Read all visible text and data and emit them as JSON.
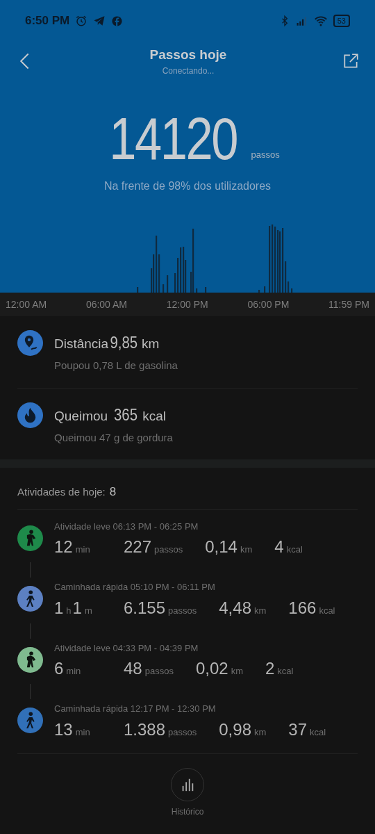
{
  "status_bar": {
    "time": "6:50 PM",
    "battery": "53"
  },
  "header": {
    "title": "Passos hoje",
    "subtitle": "Conectando..."
  },
  "summary": {
    "steps": "14120",
    "unit": "passos",
    "ranking": "Na frente de 98% dos utilizadores"
  },
  "chart_axis": [
    "12:00 AM",
    "06:00 AM",
    "12:00 PM",
    "06:00 PM",
    "11:59 PM"
  ],
  "stats": [
    {
      "kind": "distance",
      "label": "Distância",
      "value": "9,85",
      "unit": "km",
      "note": "Poupou 0,78 L de gasolina"
    },
    {
      "kind": "calories",
      "label": "Queimou",
      "value": "365",
      "unit": "kcal",
      "note": "Queimou 47 g de gordura"
    }
  ],
  "activities_header": {
    "label": "Atividades de hoje:",
    "count": "8"
  },
  "activities": [
    {
      "kind": "light",
      "color": "#1e8a4a",
      "title": "Atividade leve 06:13 PM - 06:25 PM",
      "duration": [
        {
          "value": "12",
          "unit": "min"
        }
      ],
      "steps": "227",
      "steps_unit": "passos",
      "distance": "0,14",
      "distance_unit": "km",
      "calories": "4",
      "calories_unit": "kcal"
    },
    {
      "kind": "brisk",
      "color": "#5c80c2",
      "title": "Caminhada rápida 05:10 PM - 06:11 PM",
      "duration": [
        {
          "value": "1",
          "unit": "h"
        },
        {
          "value": "1",
          "unit": "m"
        }
      ],
      "steps": "6.155",
      "steps_unit": "passos",
      "distance": "4,48",
      "distance_unit": "km",
      "calories": "166",
      "calories_unit": "kcal"
    },
    {
      "kind": "light",
      "color": "#7fba8f",
      "title": "Atividade leve 04:33 PM - 04:39 PM",
      "duration": [
        {
          "value": "6",
          "unit": "min"
        }
      ],
      "steps": "48",
      "steps_unit": "passos",
      "distance": "0,02",
      "distance_unit": "km",
      "calories": "2",
      "calories_unit": "kcal"
    },
    {
      "kind": "brisk",
      "color": "#3170b8",
      "title": "Caminhada rápida 12:17 PM - 12:30 PM",
      "duration": [
        {
          "value": "13",
          "unit": "min"
        }
      ],
      "steps": "1.388",
      "steps_unit": "passos",
      "distance": "0,98",
      "distance_unit": "km",
      "calories": "37",
      "calories_unit": "kcal"
    }
  ],
  "bottom_button": {
    "label": "Histórico"
  }
}
